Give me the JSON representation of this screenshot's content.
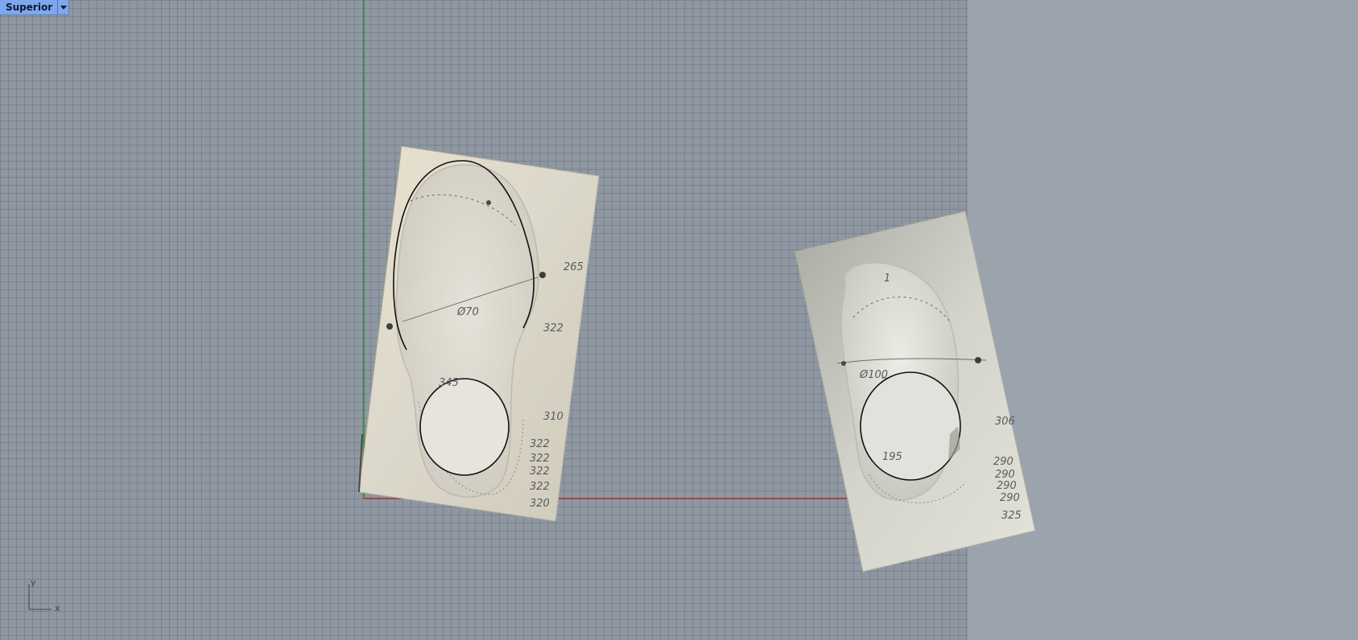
{
  "viewport": {
    "title": "Superior",
    "dropdown_icon": "chevron-down-icon"
  },
  "axes": {
    "x_label": "x",
    "y_label": "y",
    "x_axis_color": "#b03030",
    "y_axis_color": "#2e8b2e"
  },
  "images": {
    "left": {
      "annotations": [
        "265",
        "322",
        "Ø70",
        "345",
        "310",
        "322",
        "322",
        "322",
        "322",
        "320"
      ]
    },
    "right": {
      "annotations": [
        "1",
        "Ø100",
        "195",
        "306",
        "290",
        "290",
        "290",
        "290",
        "325"
      ]
    }
  },
  "colors": {
    "viewport_background": "#9ba3ac",
    "grid_line": "#78808a",
    "tab_active": "#7da7ee",
    "paper": "#e2ddd0"
  }
}
